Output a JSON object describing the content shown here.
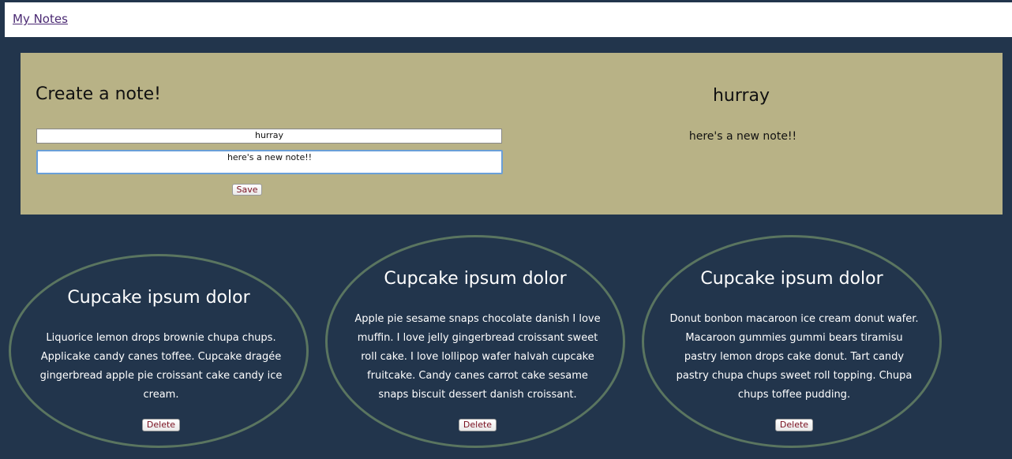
{
  "nav": {
    "title": "My Notes"
  },
  "create": {
    "heading": "Create a note!",
    "title_value": "hurray",
    "body_value": "here's a new note!!",
    "save_label": "Save"
  },
  "preview": {
    "title": "hurray",
    "body": "here's a new note!!"
  },
  "notes": [
    {
      "title": "Cupcake ipsum dolor",
      "body": "Liquorice lemon drops brownie chupa chups. Applicake candy canes toffee. Cupcake dragée gingerbread apple pie croissant cake candy ice cream.",
      "delete_label": "Delete"
    },
    {
      "title": "Cupcake ipsum dolor",
      "body": "Apple pie sesame snaps chocolate danish I love muffin. I love jelly gingerbread croissant sweet roll cake. I love lollipop wafer halvah cupcake fruitcake. Candy canes carrot cake sesame snaps biscuit dessert danish croissant.",
      "delete_label": "Delete"
    },
    {
      "title": "Cupcake ipsum dolor",
      "body": "Donut bonbon macaroon ice cream donut wafer. Macaroon gummies gummi bears tiramisu pastry lemon drops cake donut. Tart candy pastry chupa chups sweet roll topping. Chupa chups toffee pudding.",
      "delete_label": "Delete"
    }
  ],
  "colors": {
    "background": "#22354c",
    "panel": "#b8b286",
    "card_border": "#5a7560",
    "link": "#4b2a73",
    "button_text": "#7a1020"
  }
}
